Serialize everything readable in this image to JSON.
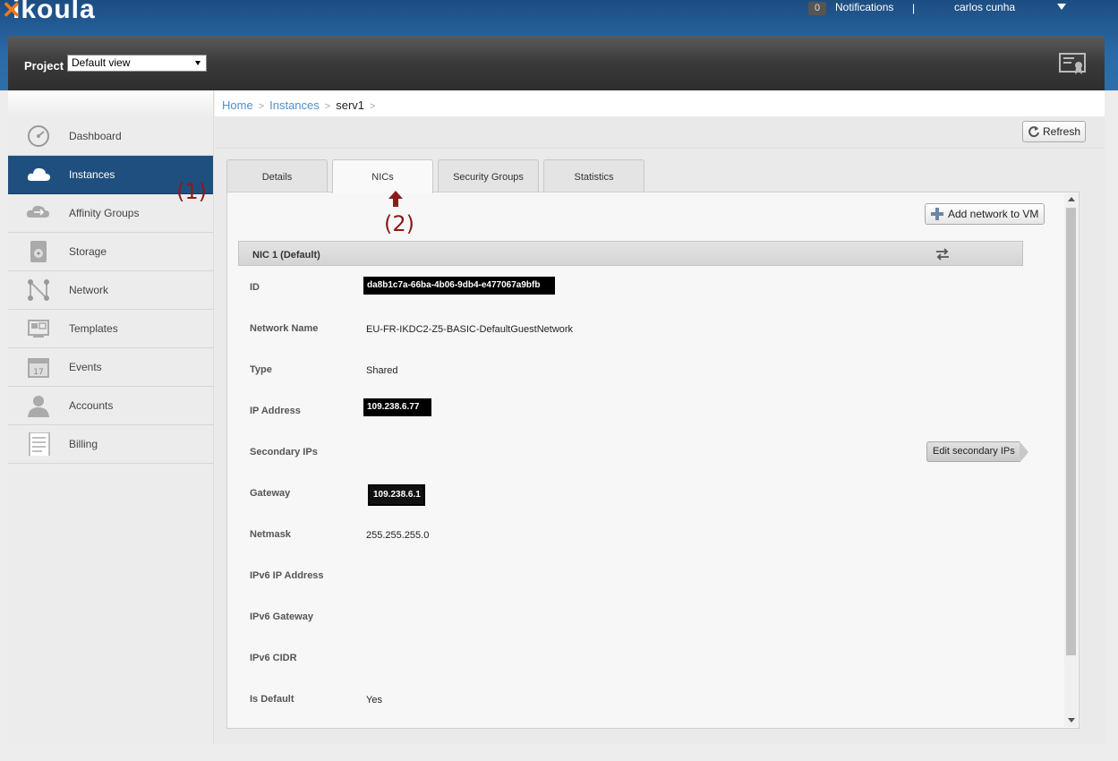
{
  "header": {
    "logo_text": "ikoula",
    "notifications_count": "0",
    "notifications_label": "Notifications",
    "separator": "|",
    "user_name": "carlos cunha"
  },
  "project": {
    "label": "Project",
    "selected": "Default view"
  },
  "sidebar": {
    "items": [
      {
        "label": "Dashboard",
        "icon": "dashboard-icon"
      },
      {
        "label": "Instances",
        "icon": "cloud-icon",
        "active": true
      },
      {
        "label": "Affinity Groups",
        "icon": "affinity-icon"
      },
      {
        "label": "Storage",
        "icon": "storage-icon"
      },
      {
        "label": "Network",
        "icon": "network-icon"
      },
      {
        "label": "Templates",
        "icon": "templates-icon"
      },
      {
        "label": "Events",
        "icon": "calendar-icon"
      },
      {
        "label": "Accounts",
        "icon": "user-icon"
      },
      {
        "label": "Billing",
        "icon": "billing-icon"
      }
    ]
  },
  "annotations": {
    "one": "(1)",
    "two": "(2)"
  },
  "breadcrumb": {
    "home": "Home",
    "instances": "Instances",
    "current": "serv1",
    "sep": ">"
  },
  "toolbar": {
    "refresh_label": "Refresh"
  },
  "tabs": [
    {
      "label": "Details"
    },
    {
      "label": "NICs",
      "active": true
    },
    {
      "label": "Security Groups"
    },
    {
      "label": "Statistics"
    }
  ],
  "nic": {
    "add_network_label": "Add network to VM",
    "title": "NIC 1 (Default)",
    "edit_secondary_label": "Edit secondary IPs",
    "fields": [
      {
        "label": "ID",
        "value": "da8b1c7a-66ba-4b06-9db4-e477067a9bfb"
      },
      {
        "label": "Network Name",
        "value": "EU-FR-IKDC2-Z5-BASIC-DefaultGuestNetwork"
      },
      {
        "label": "Type",
        "value": "Shared"
      },
      {
        "label": "IP Address",
        "value": "109.238.6.77"
      },
      {
        "label": "Secondary IPs",
        "value": ""
      },
      {
        "label": "Gateway",
        "value": "109.238.6.1"
      },
      {
        "label": "Netmask",
        "value": "255.255.255.0"
      },
      {
        "label": "IPv6 IP Address",
        "value": ""
      },
      {
        "label": "IPv6 Gateway",
        "value": ""
      },
      {
        "label": "IPv6 CIDR",
        "value": ""
      },
      {
        "label": "Is Default",
        "value": "Yes"
      }
    ]
  },
  "colors": {
    "header_blue": "#1c4d82",
    "active_nav": "#1f4f7e",
    "link_blue": "#4f8fd0",
    "annotation_red": "#8a1b1b"
  }
}
